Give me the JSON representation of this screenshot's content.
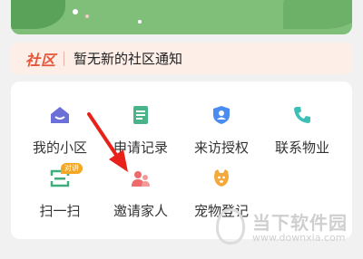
{
  "notice": {
    "tag": "社区",
    "text": "暂无新的社区通知"
  },
  "services": [
    {
      "label": "我的小区",
      "icon": "home-icon",
      "color": "#6b6fd8"
    },
    {
      "label": "申请记录",
      "icon": "document-icon",
      "color": "#49b48a"
    },
    {
      "label": "来访授权",
      "icon": "shield-user-icon",
      "color": "#4a8cf0"
    },
    {
      "label": "联系物业",
      "icon": "phone-icon",
      "color": "#3dbfb6"
    },
    {
      "label": "扫一扫",
      "icon": "scan-icon",
      "color": "#3fae7a",
      "badge": "对讲"
    },
    {
      "label": "邀请家人",
      "icon": "family-icon",
      "color": "#ef6b6b"
    },
    {
      "label": "宠物登记",
      "icon": "pet-icon",
      "color": "#f3a93b"
    }
  ],
  "watermark": {
    "title": "当下软件园",
    "url": "www.downxia.com"
  },
  "colors": {
    "notice_accent": "#e5553a",
    "arrow": "#e8221b",
    "banner": "#7fbf7a"
  }
}
